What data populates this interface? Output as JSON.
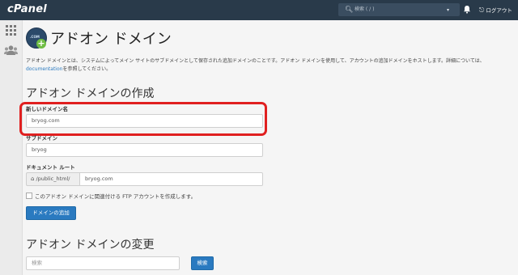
{
  "header": {
    "logo": "cPanel",
    "search_placeholder": "検索 ( / )",
    "logout_label": "ログアウト"
  },
  "page": {
    "title": "アドオン ドメイン",
    "description_part1": "アドオン ドメインとは、システムによってメイン サイトのサブドメインとして保存された追加ドメインのことです。アドオン ドメインを使用して、アカウントの追加ドメインをホストします。詳細については、",
    "description_link": "documentation",
    "description_part2": "を参照してください。"
  },
  "create_form": {
    "section_title": "アドオン ドメインの作成",
    "new_domain_label": "新しいドメイン名",
    "new_domain_value": "bryog.com",
    "subdomain_label": "サブドメイン",
    "subdomain_value": "bryog",
    "docroot_label": "ドキュメント ルート",
    "docroot_prefix": "/public_html/",
    "docroot_value": "bryog.com",
    "ftp_checkbox_label": "このアドオン ドメインに関連付ける FTP アカウントを作成します。",
    "submit_label": "ドメインの追加"
  },
  "modify_section": {
    "section_title": "アドオン ドメインの変更",
    "search_placeholder": "検索",
    "search_button": "検索"
  }
}
